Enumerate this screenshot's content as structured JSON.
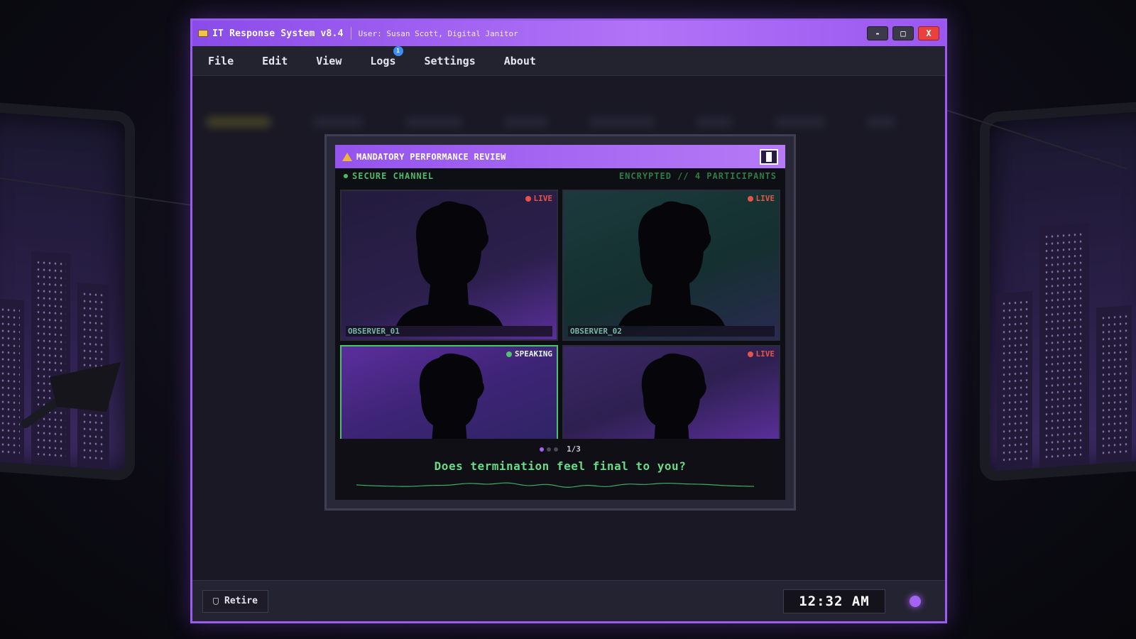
{
  "window": {
    "title": "IT Response System v8.4",
    "user": "User: Susan Scott, Digital Janitor",
    "controls": {
      "minimize": "-",
      "maximize": "□",
      "close": "X"
    }
  },
  "menu": {
    "items": [
      "File",
      "Edit",
      "View",
      "Logs",
      "Settings",
      "About"
    ],
    "logs_badge": "1"
  },
  "dialog": {
    "title": "MANDATORY PERFORMANCE REVIEW",
    "channel": "SECURE CHANNEL",
    "encryption": "ENCRYPTED // 4 PARTICIPANTS",
    "tiles": [
      {
        "status": "LIVE",
        "name": "OBSERVER_01"
      },
      {
        "status": "LIVE",
        "name": "OBSERVER_02"
      },
      {
        "status": "SPEAKING",
        "name": ""
      },
      {
        "status": "LIVE",
        "name": ""
      }
    ],
    "pager": "1/3",
    "caption": "Does termination feel final to you?"
  },
  "statusbar": {
    "retire_label": "Retire",
    "clock": "12:32 AM"
  },
  "colors": {
    "accent": "#9d5cf0",
    "live": "#e5534b",
    "speaking": "#4fc46e",
    "caption": "#66db88"
  }
}
